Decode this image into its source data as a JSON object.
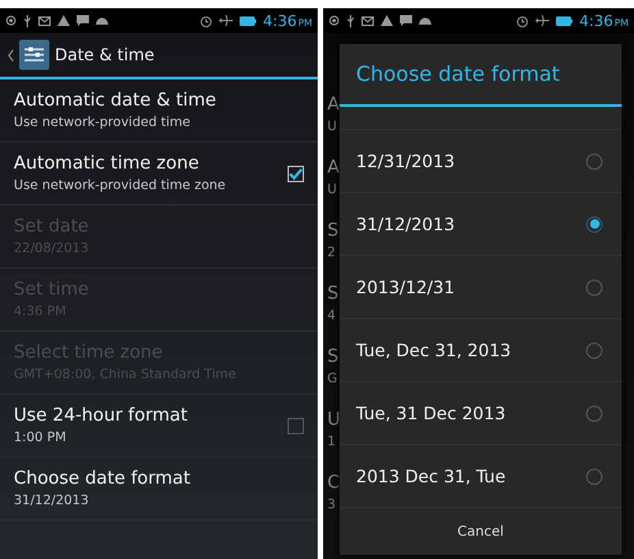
{
  "left": {
    "status_bar": {
      "time": "4:36",
      "ampm": "PM"
    },
    "action_bar": {
      "title": "Date & time"
    },
    "settings": [
      {
        "kind": "plain",
        "title": "Automatic date & time",
        "summary": "Use network-provided time",
        "disabled": false
      },
      {
        "kind": "checkbox",
        "title": "Automatic time zone",
        "summary": "Use network-provided time zone",
        "disabled": false,
        "checked": true
      },
      {
        "kind": "plain",
        "title": "Set date",
        "summary": "22/08/2013",
        "disabled": true
      },
      {
        "kind": "plain",
        "title": "Set time",
        "summary": "4:36 PM",
        "disabled": true
      },
      {
        "kind": "plain",
        "title": "Select time zone",
        "summary": "GMT+08:00, China Standard Time",
        "disabled": true
      },
      {
        "kind": "checkbox",
        "title": "Use 24-hour format",
        "summary": "1:00 PM",
        "disabled": false,
        "checked": false
      },
      {
        "kind": "plain",
        "title": "Choose date format",
        "summary": "31/12/2013",
        "disabled": false
      }
    ]
  },
  "right": {
    "status_bar": {
      "time": "4:36",
      "ampm": "PM"
    },
    "background_fragments": [
      {
        "title": "A",
        "summary": "U"
      },
      {
        "title": "A",
        "summary": "U"
      },
      {
        "title": "S",
        "summary": "2"
      },
      {
        "title": "S",
        "summary": "4"
      },
      {
        "title": "S",
        "summary": "G"
      },
      {
        "title": "U",
        "summary": "1"
      },
      {
        "title": "C",
        "summary": "3"
      }
    ],
    "dialog": {
      "title": "Choose date format",
      "options": [
        {
          "label": "12/31/2013",
          "selected": false
        },
        {
          "label": "31/12/2013",
          "selected": true
        },
        {
          "label": "2013/12/31",
          "selected": false
        },
        {
          "label": "Tue, Dec 31, 2013",
          "selected": false
        },
        {
          "label": "Tue, 31 Dec 2013",
          "selected": false
        },
        {
          "label": "2013 Dec 31, Tue",
          "selected": false
        }
      ],
      "cancel": "Cancel"
    }
  }
}
